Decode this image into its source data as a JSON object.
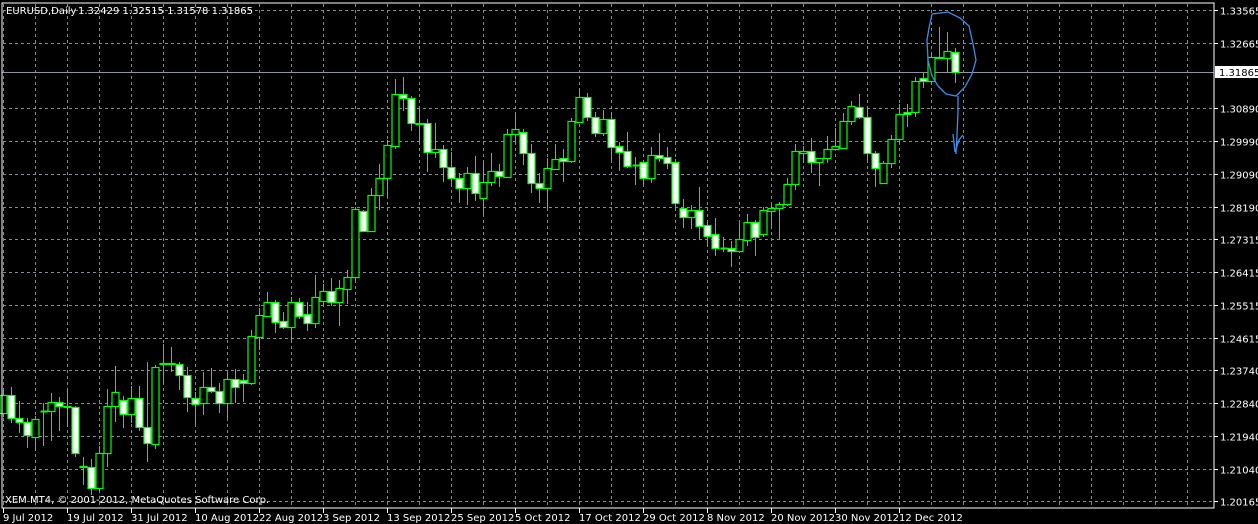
{
  "header": {
    "symbol_timeframe": "EURUSD,Daily",
    "ohlc": "1.32429 1.32515 1.31578 1.31865"
  },
  "footer": {
    "copyright": "XEM MT4, © 2001-2012, MetaQuotes Software Corp."
  },
  "colors": {
    "background": "#000000",
    "candle_outline": "#00ff00",
    "bear_body": "#ffffff",
    "bull_body": "#000000",
    "grid": "#7f8b99",
    "annotation": "#3a8ee6"
  },
  "chart_data": {
    "type": "candlestick",
    "title": "EURUSD,Daily",
    "current_price": "1.31865",
    "ylim": [
      1.20165,
      1.33565
    ],
    "y_tick_labels": [
      "1.33565",
      "1.32665",
      "1.30890",
      "1.29990",
      "1.29090",
      "1.28190",
      "1.27315",
      "1.26415",
      "1.25515",
      "1.24615",
      "1.23740",
      "1.22840",
      "1.21940",
      "1.21040",
      "1.20165"
    ],
    "x_tick_labels": [
      "9 Jul 2012",
      "19 Jul 2012",
      "31 Jul 2012",
      "10 Aug 2012",
      "22 Aug 2012",
      "3 Sep 2012",
      "13 Sep 2012",
      "25 Sep 2012",
      "5 Oct 2012",
      "17 Oct 2012",
      "29 Oct 2012",
      "8 Nov 2012",
      "20 Nov 2012",
      "30 Nov 2012",
      "12 Dec 2012"
    ],
    "x_tick_every_bars": 8,
    "grid": true,
    "candles_ohlc": [
      [
        1.2257,
        1.232,
        1.2246,
        1.2306
      ],
      [
        1.2306,
        1.2328,
        1.223,
        1.2244
      ],
      [
        1.2244,
        1.229,
        1.2203,
        1.2233
      ],
      [
        1.2233,
        1.2244,
        1.2162,
        1.2197
      ],
      [
        1.2192,
        1.2249,
        1.2154,
        1.2241
      ],
      [
        1.2263,
        1.2285,
        1.2167,
        1.2262
      ],
      [
        1.2263,
        1.2311,
        1.2181,
        1.2287
      ],
      [
        1.2287,
        1.23,
        1.2208,
        1.2276
      ],
      [
        1.2276,
        1.2317,
        1.2219,
        1.2273
      ],
      [
        1.2273,
        1.2276,
        1.2137,
        1.2148
      ],
      [
        1.2113,
        1.2137,
        1.2061,
        1.211
      ],
      [
        1.211,
        1.2132,
        1.2034,
        1.2052
      ],
      [
        1.2052,
        1.2167,
        1.2044,
        1.2148
      ],
      [
        1.2148,
        1.2323,
        1.211,
        1.2276
      ],
      [
        1.2276,
        1.2385,
        1.2233,
        1.2314
      ],
      [
        1.2293,
        1.2303,
        1.2216,
        1.2254
      ],
      [
        1.2254,
        1.2331,
        1.223,
        1.2298
      ],
      [
        1.2298,
        1.2331,
        1.2208,
        1.2219
      ],
      [
        1.2219,
        1.2396,
        1.2124,
        1.2175
      ],
      [
        1.2173,
        1.2388,
        1.2159,
        1.2383
      ],
      [
        1.2391,
        1.2445,
        1.2333,
        1.2393
      ],
      [
        1.2393,
        1.2437,
        1.2369,
        1.239
      ],
      [
        1.2391,
        1.2396,
        1.232,
        1.2361
      ],
      [
        1.2361,
        1.2383,
        1.226,
        1.23
      ],
      [
        1.2298,
        1.2314,
        1.2227,
        1.2282
      ],
      [
        1.2285,
        1.2369,
        1.2252,
        1.2328
      ],
      [
        1.2328,
        1.238,
        1.2312,
        1.2317
      ],
      [
        1.2317,
        1.2339,
        1.2257,
        1.2285
      ],
      [
        1.2285,
        1.2366,
        1.2244,
        1.235
      ],
      [
        1.235,
        1.2377,
        1.2285,
        1.2328
      ],
      [
        1.2347,
        1.2363,
        1.2287,
        1.2339
      ],
      [
        1.2339,
        1.2484,
        1.2333,
        1.2467
      ],
      [
        1.2464,
        1.2544,
        1.2429,
        1.2525
      ],
      [
        1.2522,
        1.2587,
        1.2519,
        1.256
      ],
      [
        1.256,
        1.2565,
        1.2475,
        1.2505
      ],
      [
        1.2508,
        1.2533,
        1.2486,
        1.2492
      ],
      [
        1.2492,
        1.2574,
        1.2456,
        1.256
      ],
      [
        1.256,
        1.2571,
        1.2514,
        1.2522
      ],
      [
        1.2527,
        1.256,
        1.2481,
        1.2503
      ],
      [
        1.2503,
        1.2634,
        1.2489,
        1.2574
      ],
      [
        1.2563,
        1.2609,
        1.2552,
        1.259
      ],
      [
        1.259,
        1.2625,
        1.2549,
        1.256
      ],
      [
        1.256,
        1.262,
        1.2495,
        1.2598
      ],
      [
        1.2595,
        1.2647,
        1.2554,
        1.2628
      ],
      [
        1.2628,
        1.2819,
        1.2617,
        1.2814
      ],
      [
        1.2808,
        1.2811,
        1.2751,
        1.2754
      ],
      [
        1.2754,
        1.2871,
        1.2751,
        1.2852
      ],
      [
        1.2852,
        1.2936,
        1.2811,
        1.2898
      ],
      [
        1.2898,
        1.3002,
        1.2846,
        1.2988
      ],
      [
        1.2985,
        1.3168,
        1.2977,
        1.3127
      ],
      [
        1.3127,
        1.3174,
        1.3081,
        1.3116
      ],
      [
        1.3116,
        1.3122,
        1.3026,
        1.3048
      ],
      [
        1.3048,
        1.3086,
        1.2994,
        1.3046
      ],
      [
        1.3048,
        1.3059,
        1.2914,
        1.2969
      ],
      [
        1.2969,
        1.3048,
        1.2952,
        1.2977
      ],
      [
        1.2977,
        1.2988,
        1.2887,
        1.2928
      ],
      [
        1.2928,
        1.2969,
        1.2882,
        1.2898
      ],
      [
        1.2898,
        1.2912,
        1.283,
        1.2871
      ],
      [
        1.2871,
        1.2928,
        1.2824,
        1.2912
      ],
      [
        1.2912,
        1.2958,
        1.2835,
        1.2857
      ],
      [
        1.2844,
        1.2939,
        1.28,
        1.2887
      ],
      [
        1.2887,
        1.2966,
        1.2876,
        1.2917
      ],
      [
        1.2917,
        1.2936,
        1.2874,
        1.2904
      ],
      [
        1.2901,
        1.3032,
        1.2901,
        1.3018
      ],
      [
        1.3018,
        1.3073,
        1.2994,
        1.3032
      ],
      [
        1.3024,
        1.3032,
        1.2934,
        1.2966
      ],
      [
        1.2966,
        1.2991,
        1.2857,
        1.2884
      ],
      [
        1.2884,
        1.2912,
        1.283,
        1.2871
      ],
      [
        1.2871,
        1.2952,
        1.2816,
        1.2925
      ],
      [
        1.2923,
        1.2991,
        1.292,
        1.295
      ],
      [
        1.2952,
        1.2977,
        1.2887,
        1.2944
      ],
      [
        1.2944,
        1.3062,
        1.2939,
        1.3054
      ],
      [
        1.3051,
        1.3144,
        1.3051,
        1.3119
      ],
      [
        1.3119,
        1.313,
        1.3054,
        1.3065
      ],
      [
        1.3065,
        1.3078,
        1.301,
        1.3021
      ],
      [
        1.3021,
        1.3084,
        1.3013,
        1.3059
      ],
      [
        1.3059,
        1.3078,
        1.2944,
        1.2983
      ],
      [
        1.2985,
        1.2996,
        1.2917,
        1.2969
      ],
      [
        1.2972,
        1.3024,
        1.2925,
        1.2931
      ],
      [
        1.2934,
        1.2955,
        1.2879,
        1.2933
      ],
      [
        1.2942,
        1.2944,
        1.2882,
        1.2898
      ],
      [
        1.2898,
        1.2983,
        1.2884,
        1.2961
      ],
      [
        1.2961,
        1.3021,
        1.2942,
        1.2952
      ],
      [
        1.2955,
        1.2983,
        1.2923,
        1.2939
      ],
      [
        1.2942,
        1.295,
        1.2816,
        1.283
      ],
      [
        1.2816,
        1.2841,
        1.2761,
        1.2792
      ],
      [
        1.2792,
        1.2824,
        1.2759,
        1.2811
      ],
      [
        1.2811,
        1.2874,
        1.2732,
        1.2767
      ],
      [
        1.277,
        1.2778,
        1.2713,
        1.274
      ],
      [
        1.2745,
        1.2789,
        1.2685,
        1.2707
      ],
      [
        1.2707,
        1.2737,
        1.2696,
        1.2707
      ],
      [
        1.2707,
        1.2726,
        1.2655,
        1.2699
      ],
      [
        1.2699,
        1.2775,
        1.2696,
        1.2732
      ],
      [
        1.2729,
        1.28,
        1.2713,
        1.2778
      ],
      [
        1.2778,
        1.2784,
        1.2685,
        1.2737
      ],
      [
        1.2745,
        1.2819,
        1.2737,
        1.2811
      ],
      [
        1.2808,
        1.2827,
        1.2759,
        1.2816
      ],
      [
        1.2816,
        1.2833,
        1.2732,
        1.2827
      ],
      [
        1.2827,
        1.2898,
        1.2822,
        1.2882
      ],
      [
        1.2882,
        1.2991,
        1.2865,
        1.2972
      ],
      [
        1.2966,
        1.2985,
        1.2942,
        1.2972
      ],
      [
        1.2972,
        1.3007,
        1.2912,
        1.2942
      ],
      [
        1.2942,
        1.2952,
        1.2876,
        1.2952
      ],
      [
        1.2952,
        1.3013,
        1.2939,
        1.2977
      ],
      [
        1.2977,
        1.3035,
        1.2974,
        1.2985
      ],
      [
        1.298,
        1.3075,
        1.2977,
        1.3054
      ],
      [
        1.3054,
        1.3108,
        1.3043,
        1.3094
      ],
      [
        1.3092,
        1.3127,
        1.3059,
        1.3065
      ],
      [
        1.3065,
        1.3086,
        1.2947,
        1.2966
      ],
      [
        1.2966,
        1.2972,
        1.2874,
        1.2925
      ],
      [
        1.2884,
        1.2944,
        1.2884,
        1.2939
      ],
      [
        1.2939,
        1.3015,
        1.2925,
        1.3004
      ],
      [
        1.3004,
        1.31,
        1.2994,
        1.3073
      ],
      [
        1.3078,
        1.31,
        1.3037,
        1.3073
      ],
      [
        1.3078,
        1.3174,
        1.3065,
        1.3163
      ],
      [
        1.3171,
        1.3184,
        1.3144,
        1.3163
      ],
      [
        1.3163,
        1.3239,
        1.3163,
        1.3228
      ],
      [
        1.3228,
        1.331,
        1.3225,
        1.3226
      ],
      [
        1.3226,
        1.3296,
        1.3187,
        1.3244
      ],
      [
        1.32429,
        1.32515,
        1.31578,
        1.31865
      ]
    ]
  }
}
